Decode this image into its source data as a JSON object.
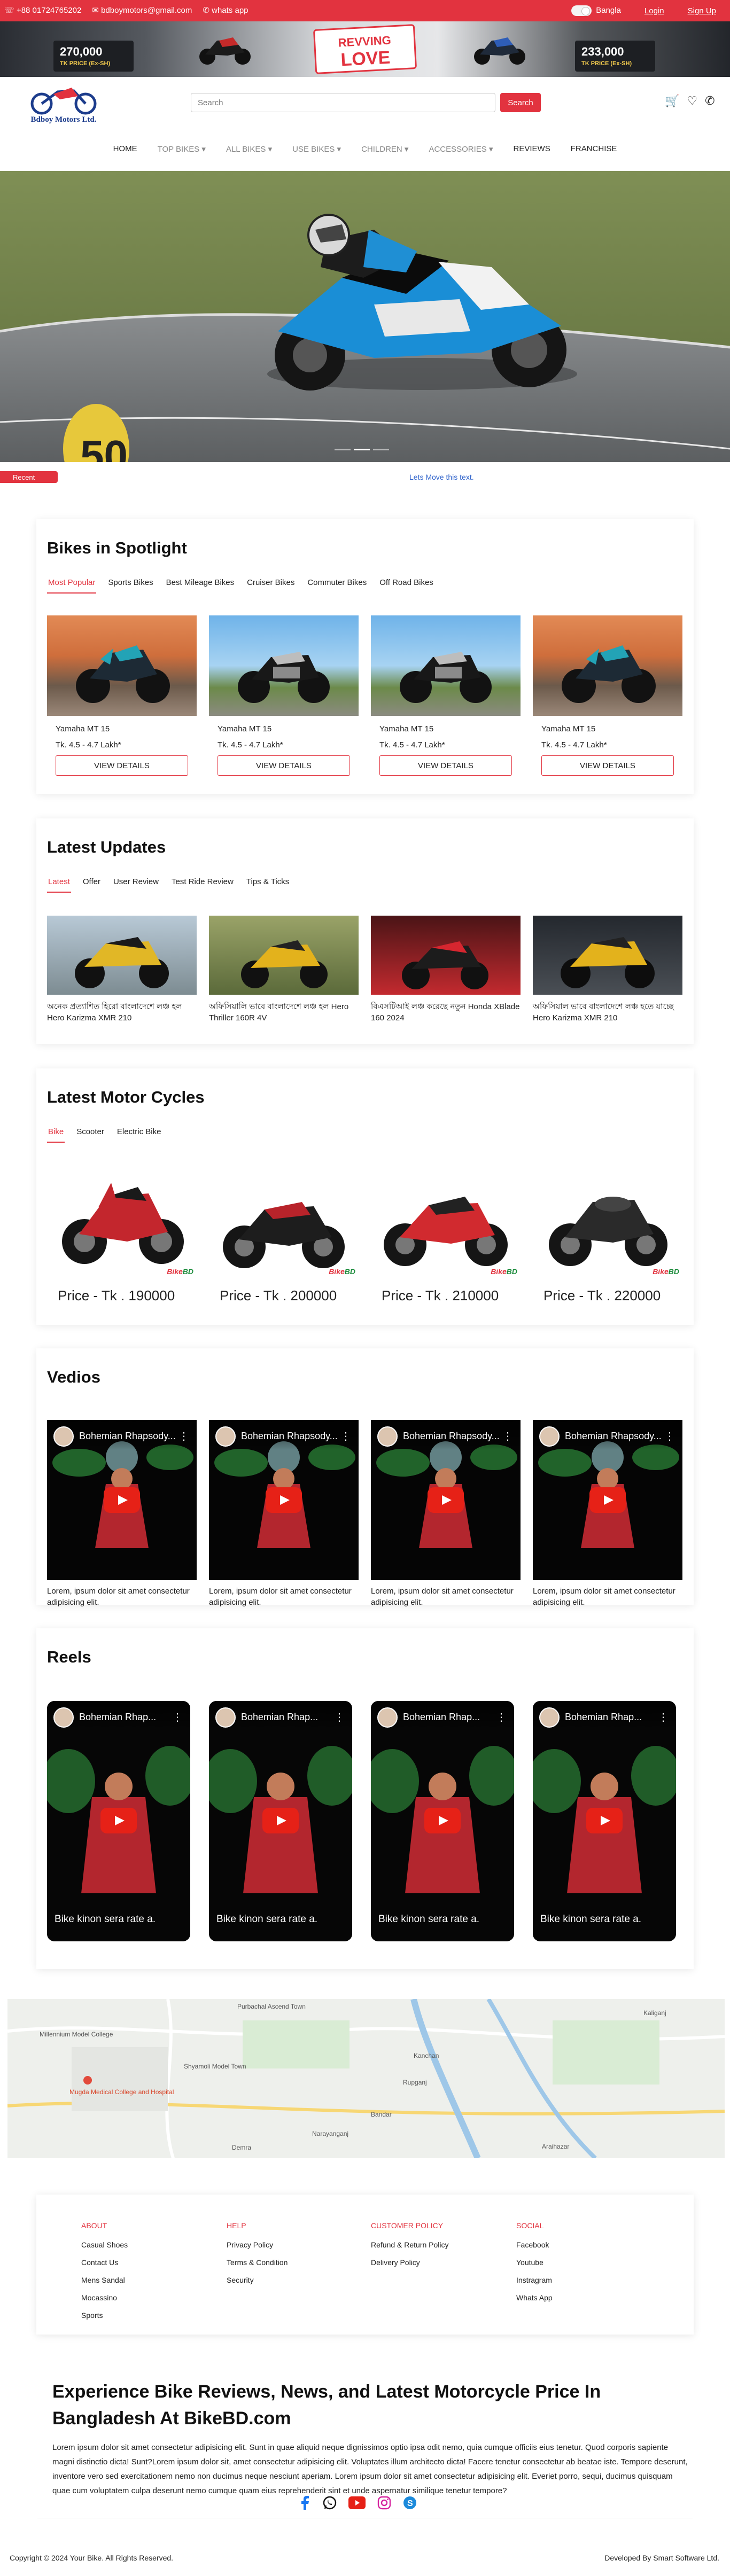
{
  "topbar": {
    "phone": "+88 01724765202",
    "email": "bdboymotors@gmail.com",
    "whatsapp": "whats app",
    "language": "Bangla",
    "login": "Login",
    "signup": "Sign Up"
  },
  "banner": {
    "left_price": "270,000",
    "left_price_label": "TK PRICE (Ex-SH)",
    "center_line1": "REVVING",
    "center_line2": "LOVE",
    "right_price": "233,000",
    "right_price_label": "TK PRICE (Ex-SH)"
  },
  "header": {
    "logo_text": "Bdboy Motors Ltd.",
    "search_placeholder": "Search",
    "search_button": "Search"
  },
  "nav": {
    "items": [
      {
        "label": "HOME",
        "dropdown": false
      },
      {
        "label": "TOP BIKES",
        "dropdown": true
      },
      {
        "label": "ALL BIKES",
        "dropdown": true
      },
      {
        "label": "USE BIKES",
        "dropdown": true
      },
      {
        "label": "CHILDREN",
        "dropdown": true
      },
      {
        "label": "ACCESSORIES",
        "dropdown": true
      },
      {
        "label": "REVIEWS",
        "dropdown": false
      },
      {
        "label": "FRANCHISE",
        "dropdown": false
      }
    ]
  },
  "marquee": {
    "recent_label": "Recent",
    "text": "Lets Move this text."
  },
  "spotlight": {
    "title": "Bikes in Spotlight",
    "tabs": [
      "Most Popular",
      "Sports Bikes",
      "Best Mileage Bikes",
      "Cruiser Bikes",
      "Commuter Bikes",
      "Off Road Bikes"
    ],
    "items": [
      {
        "name": "Yamaha MT 15",
        "price": "Tk. 4.5 - 4.7 Lakh*",
        "button": "VIEW DETAILS"
      },
      {
        "name": "Yamaha MT 15",
        "price": "Tk. 4.5 - 4.7 Lakh*",
        "button": "VIEW DETAILS"
      },
      {
        "name": "Yamaha MT 15",
        "price": "Tk. 4.5 - 4.7 Lakh*",
        "button": "VIEW DETAILS"
      },
      {
        "name": "Yamaha MT 15",
        "price": "Tk. 4.5 - 4.7 Lakh*",
        "button": "VIEW DETAILS"
      }
    ]
  },
  "updates": {
    "title": "Latest Updates",
    "tabs": [
      "Latest",
      "Offer",
      "User Review",
      "Test Ride Review",
      "Tips & Ticks"
    ],
    "items": [
      {
        "title": "অনেক প্রত্যাশিত হিরো বাংলাদেশে লঞ্চ হল Hero Karizma XMR 210"
      },
      {
        "title": "অফিসিয়ালি ভাবে বাংলাদেশে লঞ্চ হল Hero Thriller 160R 4V"
      },
      {
        "title": "বিএসটিআই লঞ্চ করেছে নতুন Honda XBlade 160 2024"
      },
      {
        "title": "অফিসিয়াল ভাবে বাংলাদেশে লঞ্চ হতে যাচ্ছে Hero Karizma XMR 210"
      }
    ]
  },
  "motorcycles": {
    "title": "Latest Motor Cycles",
    "tabs": [
      "Bike",
      "Scooter",
      "Electric Bike"
    ],
    "watermark_a": "Bike",
    "watermark_b": "BD",
    "items": [
      {
        "price": "Price - Tk . 190000"
      },
      {
        "price": "Price - Tk . 200000"
      },
      {
        "price": "Price - Tk . 210000"
      },
      {
        "price": "Price - Tk . 220000"
      }
    ]
  },
  "videos": {
    "title": "Vedios",
    "items": [
      {
        "video_title": "Bohemian Rhapsody...",
        "caption": "Lorem, ipsum dolor sit amet consectetur adipisicing elit."
      },
      {
        "video_title": "Bohemian Rhapsody...",
        "caption": "Lorem, ipsum dolor sit amet consectetur adipisicing elit."
      },
      {
        "video_title": "Bohemian Rhapsody...",
        "caption": "Lorem, ipsum dolor sit amet consectetur adipisicing elit."
      },
      {
        "video_title": "Bohemian Rhapsody...",
        "caption": "Lorem, ipsum dolor sit amet consectetur adipisicing elit."
      }
    ]
  },
  "reels": {
    "title": "Reels",
    "items": [
      {
        "video_title": "Bohemian Rhap...",
        "caption": "Bike kinon sera rate a."
      },
      {
        "video_title": "Bohemian Rhap...",
        "caption": "Bike kinon sera rate a."
      },
      {
        "video_title": "Bohemian Rhap...",
        "caption": "Bike kinon sera rate a."
      },
      {
        "video_title": "Bohemian Rhap...",
        "caption": "Bike kinon sera rate a."
      }
    ]
  },
  "map": {
    "labels": [
      "Purbachal Ascend Town",
      "Millennium Model College",
      "Shyamoli Model Town",
      "Mugda Medical College and Hospital",
      "Demra",
      "Narayanganj",
      "Rupganj",
      "Kanchan",
      "Bandar",
      "Kaliganj",
      "Araihazar"
    ]
  },
  "footer": {
    "columns": [
      {
        "heading": "ABOUT",
        "links": [
          "Casual Shoes",
          "Contact Us",
          "Mens Sandal",
          "Mocassino",
          "Sports"
        ]
      },
      {
        "heading": "HELP",
        "links": [
          "Privacy Policy",
          "Terms & Condition",
          "Security"
        ]
      },
      {
        "heading": "CUSTOMER POLICY",
        "links": [
          "Refund & Return Policy",
          "Delivery Policy"
        ]
      },
      {
        "heading": "SOCIAL",
        "links": [
          "Facebook",
          "Youtube",
          "Instragram",
          "Whats App"
        ]
      }
    ]
  },
  "about": {
    "title": "Experience Bike Reviews, News, and Latest Motorcycle Price In Bangladesh At BikeBD.com",
    "body": "Lorem ipsum dolor sit amet consectetur adipisicing elit. Sunt in quae aliquid neque dignissimos optio ipsa odit nemo, quia cumque officiis eius tenetur. Quod corporis sapiente magni distinctio dicta! Sunt?Lorem ipsum dolor sit, amet consectetur adipisicing elit. Voluptates illum architecto dicta! Facere tenetur consectetur ab beatae iste. Tempore deserunt, inventore vero sed exercitationem nemo non ducimus neque nesciunt aperiam. Lorem ipsum dolor sit amet consectetur adipisicing elit. Everiet porro, sequi, ducimus quisquam quae cum voluptatem culpa deserunt nemo cumque quam eius reprehenderit sint et unde aspernatur similique tenetur tempore?"
  },
  "bottom": {
    "copyright": "Copyright © 2024 Your Bike. All Rights Reserved.",
    "developed": "Developed By Smart Software Ltd."
  },
  "colors": {
    "brand_red": "#e2333f",
    "link_blue": "#3366cc"
  }
}
